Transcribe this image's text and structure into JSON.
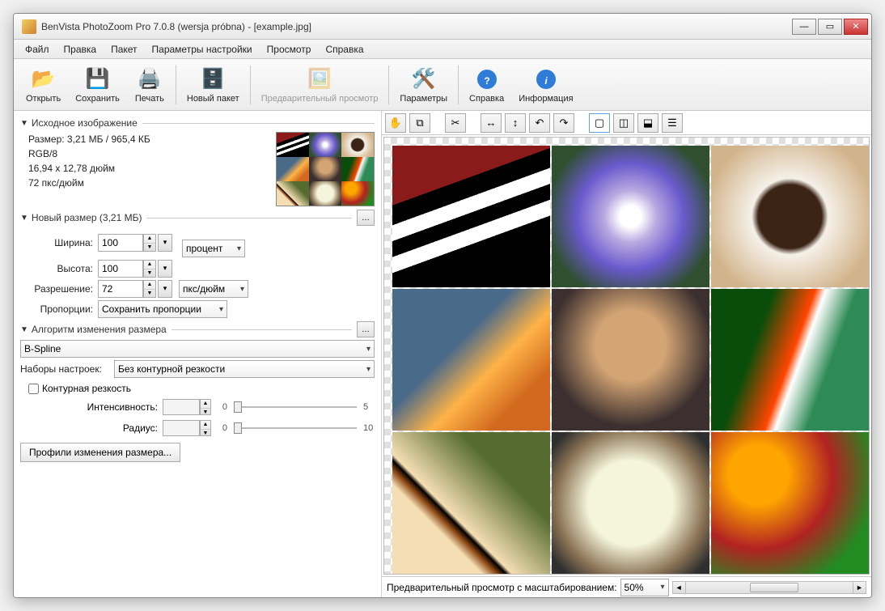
{
  "title": "BenVista PhotoZoom Pro 7.0.8 (wersja próbna) - [example.jpg]",
  "menu": [
    "Файл",
    "Правка",
    "Пакет",
    "Параметры настройки",
    "Просмотр",
    "Справка"
  ],
  "toolbar": {
    "open": "Открыть",
    "save": "Сохранить",
    "print": "Печать",
    "newbatch": "Новый пакет",
    "preview": "Предварительный просмотр",
    "params": "Параметры",
    "help": "Справка",
    "info": "Информация"
  },
  "source": {
    "header": "Исходное изображение",
    "size": "Размер: 3,21 МБ / 965,4 КБ",
    "mode": "RGB/8",
    "dims": "16,94 x 12,78 дюйм",
    "dpi": "72 пкс/дюйм"
  },
  "newsize": {
    "header": "Новый размер (3,21 МБ)",
    "width_label": "Ширина:",
    "width_value": "100",
    "height_label": "Высота:",
    "height_value": "100",
    "unit": "процент",
    "res_label": "Разрешение:",
    "res_value": "72",
    "res_unit": "пкс/дюйм",
    "prop_label": "Пропорции:",
    "prop_value": "Сохранить пропорции"
  },
  "algo": {
    "header": "Алгоритм изменения размера",
    "method": "B-Spline",
    "presets_label": "Наборы настроек:",
    "presets_value": "Без контурной резкости",
    "unsharp": "Контурная резкость",
    "intensity_label": "Интенсивность:",
    "intensity_min": "0",
    "intensity_max": "5",
    "radius_label": "Радиус:",
    "radius_min": "0",
    "radius_max": "10",
    "profiles_btn": "Профили изменения размера..."
  },
  "previewbar": {
    "label": "Предварительный просмотр с масштабированием:",
    "zoom": "50%"
  }
}
